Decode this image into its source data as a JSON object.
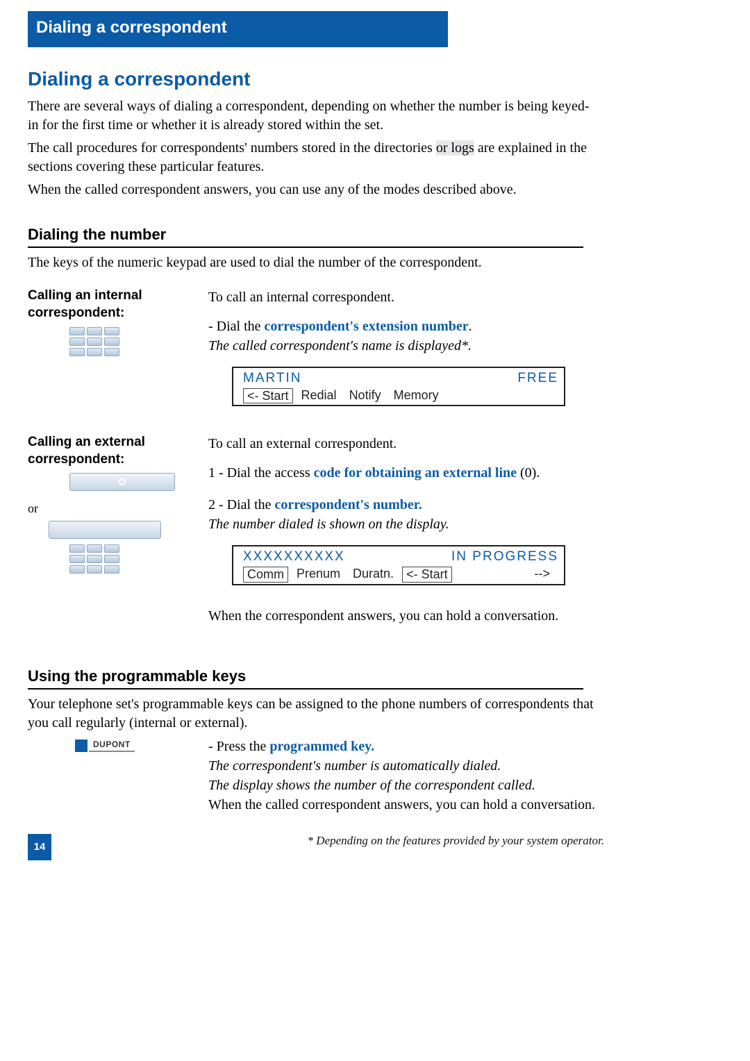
{
  "tab_title": "Dialing a correspondent",
  "h1": "Dialing a correspondent",
  "intro": {
    "p1a": "There are several ways of dialing a correspondent, depending on whether the number is being keyed-in for the first time or whether it is already stored within the set.",
    "p2a": "The call procedures for correspondents' numbers stored in the directories ",
    "p2_hl": "or logs",
    "p2b": " are explained in the sections covering these particular features.",
    "p3": "When the called correspondent answers, you can use any of the modes described above."
  },
  "sec1_title": "Dialing the number",
  "sec1_lead": "The keys of the numeric keypad are used to dial the number of the correspondent.",
  "internal": {
    "label": "Calling an internal correspondent:",
    "lead": "To call an internal correspondent.",
    "step_pre": "- Dial the ",
    "step_link": "correspondent's extension number",
    "step_post": ".",
    "result": "The called correspondent's name is displayed*.",
    "lcd_top_left": "MARTIN",
    "lcd_top_right": "FREE",
    "lcd_keys": [
      "<- Start",
      "Redial",
      "Notify",
      "Memory"
    ]
  },
  "external": {
    "label": "Calling an external correspondent:",
    "or": "or",
    "lead": "To call an external correspondent.",
    "s1_pre": "1 - Dial the access ",
    "s1_link": "code for obtaining an external line",
    "s1_post": " (0).",
    "s2_pre": "2 - Dial the ",
    "s2_link": "correspondent's number.",
    "result": "The number dialed is shown on the display.",
    "lcd_top_left": "XXXXXXXXXX",
    "lcd_top_right": "IN PROGRESS",
    "lcd_keys": [
      "Comm",
      "Prenum",
      "Duratn.",
      "<- Start",
      "-->"
    ],
    "closing": "When the correspondent answers, you can hold a conversation."
  },
  "sec2_title": "Using the programmable keys",
  "sec2_lead": "Your telephone set's programmable keys can be assigned to the phone numbers of correspondents that you call regularly (internal or external).",
  "prog": {
    "key_label": "DUPONT",
    "step_pre": "- Press the ",
    "step_link": "programmed key.",
    "r1": "The correspondent's number is automatically dialed.",
    "r2": "The display shows the number of the correspondent called.",
    "closing": "When the called correspondent answers, you can hold a conversation."
  },
  "page_number": "14",
  "footnote": "* Depending on the features provided by your system operator."
}
